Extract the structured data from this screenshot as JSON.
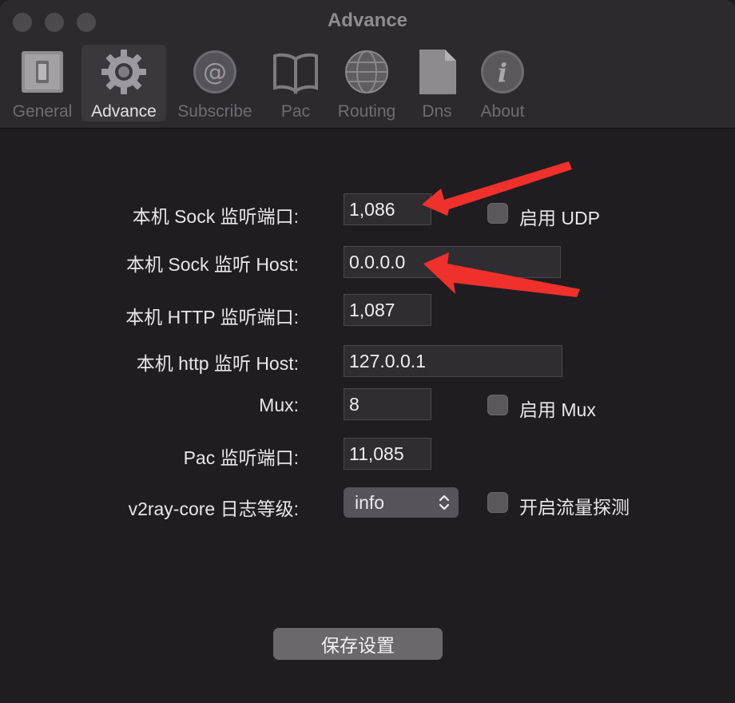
{
  "window": {
    "title": "Advance"
  },
  "toolbar": {
    "items": [
      {
        "label": "General",
        "icon": "switch-icon"
      },
      {
        "label": "Advance",
        "icon": "gear-icon"
      },
      {
        "label": "Subscribe",
        "icon": "at-icon"
      },
      {
        "label": "Pac",
        "icon": "book-icon"
      },
      {
        "label": "Routing",
        "icon": "globe-icon"
      },
      {
        "label": "Dns",
        "icon": "document-icon"
      },
      {
        "label": "About",
        "icon": "info-icon"
      }
    ],
    "selected": "Advance"
  },
  "form": {
    "sock_port": {
      "label": "本机 Sock 监听端口:",
      "value": "1,086"
    },
    "sock_host": {
      "label": "本机 Sock 监听 Host:",
      "value": "0.0.0.0"
    },
    "http_port": {
      "label": "本机 HTTP 监听端口:",
      "value": "1,087"
    },
    "http_host": {
      "label": "本机 http 监听 Host:",
      "value": "127.0.0.1"
    },
    "mux": {
      "label": "Mux:",
      "value": "8"
    },
    "pac_port": {
      "label": "Pac 监听端口:",
      "value": "11,085"
    },
    "log_level": {
      "label": "v2ray-core 日志等级:",
      "value": "info"
    },
    "enable_udp": {
      "label": "启用 UDP",
      "checked": false
    },
    "enable_mux": {
      "label": "启用 Mux",
      "checked": false
    },
    "enable_sniffing": {
      "label": "开启流量探测",
      "checked": false
    }
  },
  "save_button": {
    "label": "保存设置"
  },
  "annotation_colors": {
    "arrow": "#f0302a"
  }
}
